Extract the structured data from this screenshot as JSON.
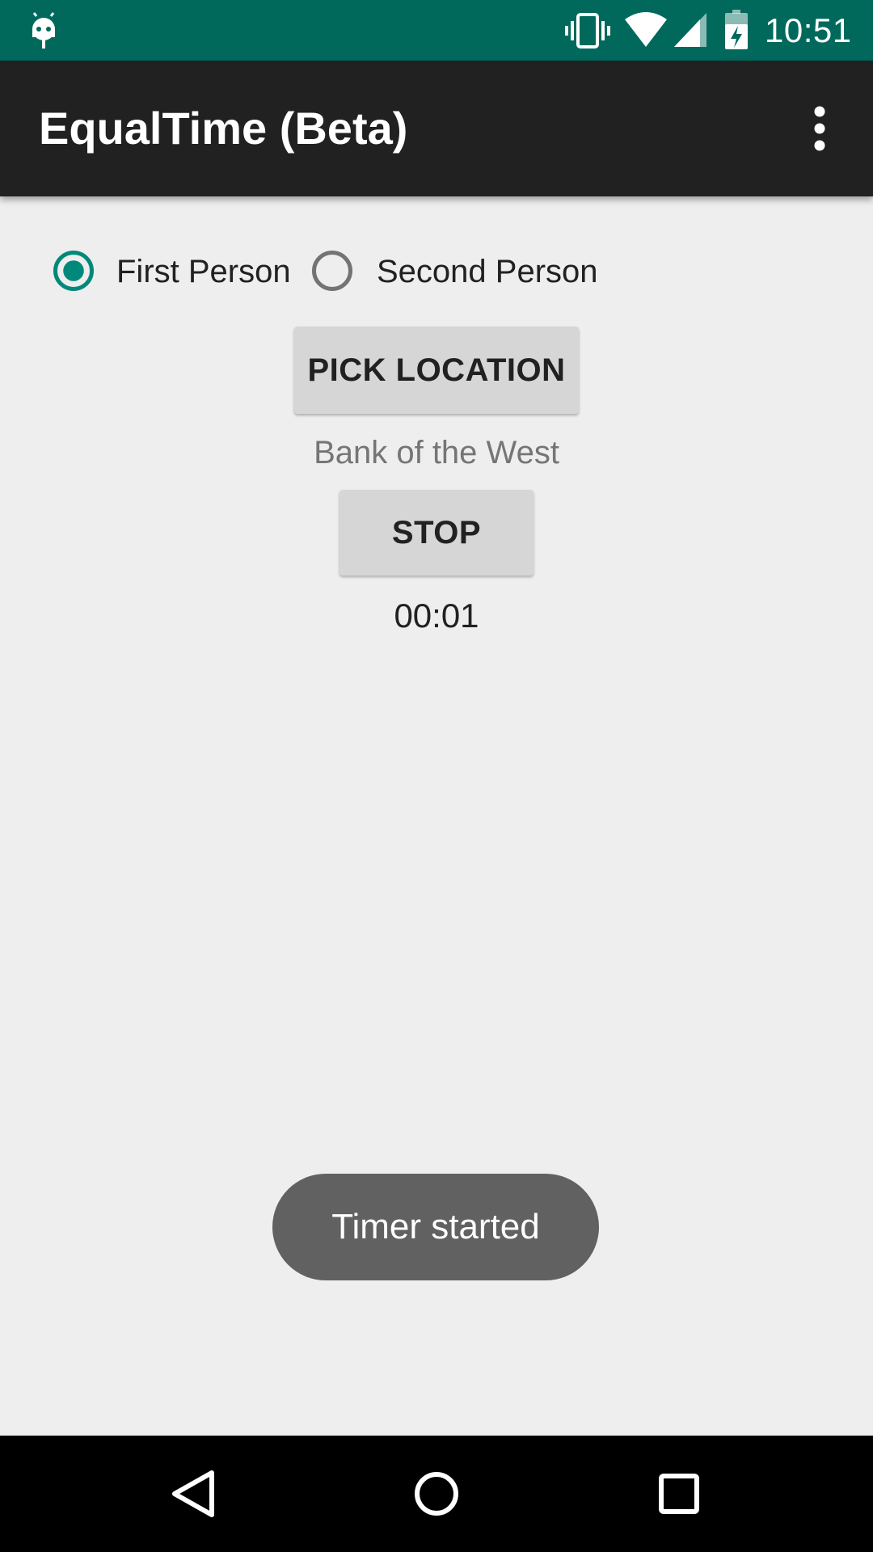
{
  "status_bar": {
    "time": "10:51",
    "icons": [
      "android-debug-icon",
      "vibrate-icon",
      "wifi-icon",
      "signal-icon",
      "battery-charging-icon"
    ]
  },
  "app_bar": {
    "title": "EqualTime (Beta)",
    "menu_icon": "more-vert-icon"
  },
  "radio_group": {
    "options": [
      {
        "label": "First Person",
        "checked": true
      },
      {
        "label": "Second Person",
        "checked": false
      }
    ]
  },
  "pick_location": {
    "label": "PICK LOCATION"
  },
  "location": {
    "name": "Bank of the West"
  },
  "stop": {
    "label": "STOP"
  },
  "timer": {
    "value": "00:01"
  },
  "toast": {
    "message": "Timer started"
  },
  "nav_bar": {
    "icons": [
      "back-icon",
      "home-icon",
      "recents-icon"
    ]
  },
  "colors": {
    "status_bar": "#00695c",
    "app_bar": "#212121",
    "accent": "#00897b",
    "background": "#eeeeee",
    "toast": "#616161"
  }
}
